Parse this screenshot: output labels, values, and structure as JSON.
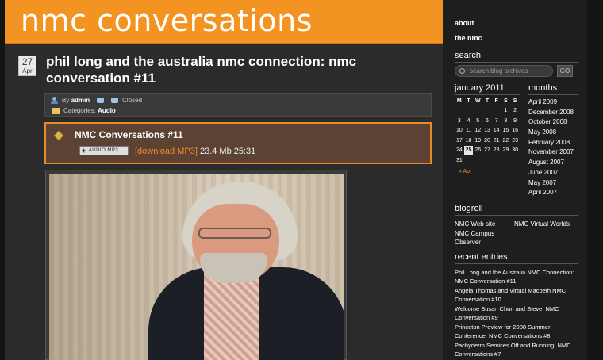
{
  "site": {
    "title": "nmc conversations"
  },
  "post": {
    "date_day": "27",
    "date_month": "Apr",
    "title": "phil long and the australia nmc connection: nmc conversation #11",
    "meta": {
      "by_label": "By",
      "author": "admin",
      "comments_status": "Closed",
      "categories_label": "Categories:",
      "category": "Audio"
    },
    "audio": {
      "title": "NMC Conversations #11",
      "badge_label": "AUDIO MP3",
      "badge_plus": "+",
      "download_label": "[download MP3]",
      "file_info": "23.4 Mb 25:31"
    }
  },
  "sidebar": {
    "nav": [
      "about",
      "the nmc"
    ],
    "search": {
      "heading": "search",
      "placeholder": "search blog archives",
      "go_label": "GO"
    },
    "calendar": {
      "heading": "january 2011",
      "weekdays": [
        "M",
        "T",
        "W",
        "T",
        "F",
        "S",
        "S"
      ],
      "weeks": [
        [
          "",
          "",
          "",
          "",
          "",
          "1",
          "2"
        ],
        [
          "3",
          "4",
          "5",
          "6",
          "7",
          "8",
          "9"
        ],
        [
          "10",
          "11",
          "12",
          "13",
          "14",
          "15",
          "16"
        ],
        [
          "17",
          "18",
          "19",
          "20",
          "21",
          "22",
          "23"
        ],
        [
          "24",
          "25",
          "26",
          "27",
          "28",
          "29",
          "30"
        ],
        [
          "31",
          "",
          "",
          "",
          "",
          "",
          ""
        ]
      ],
      "today": "25",
      "prev_label": "« Apr"
    },
    "months": {
      "heading": "months",
      "items": [
        "April 2009",
        "December 2008",
        "October 2008",
        "May 2008",
        "February 2008",
        "November 2007",
        "August 2007",
        "June 2007",
        "May 2007",
        "April 2007"
      ]
    },
    "blogroll": {
      "heading": "blogroll",
      "items": [
        "NMC Web site",
        "NMC Virtual Worlds",
        "NMC Campus Observer"
      ]
    },
    "recent": {
      "heading": "recent entries",
      "items": [
        "Phil Long and the Australia NMC Connection: NMC Conversation #11",
        "Angela Thomas and Virtual Macbeth NMC Conversation #10",
        "Welcome Susan Chun and Steve: NMC Conversation #9",
        "Princeton Preview for 2008 Summer Conference: NMC Conversations #8",
        "Pachyderm Services Off and Running: NMC Conversations #7"
      ]
    }
  }
}
